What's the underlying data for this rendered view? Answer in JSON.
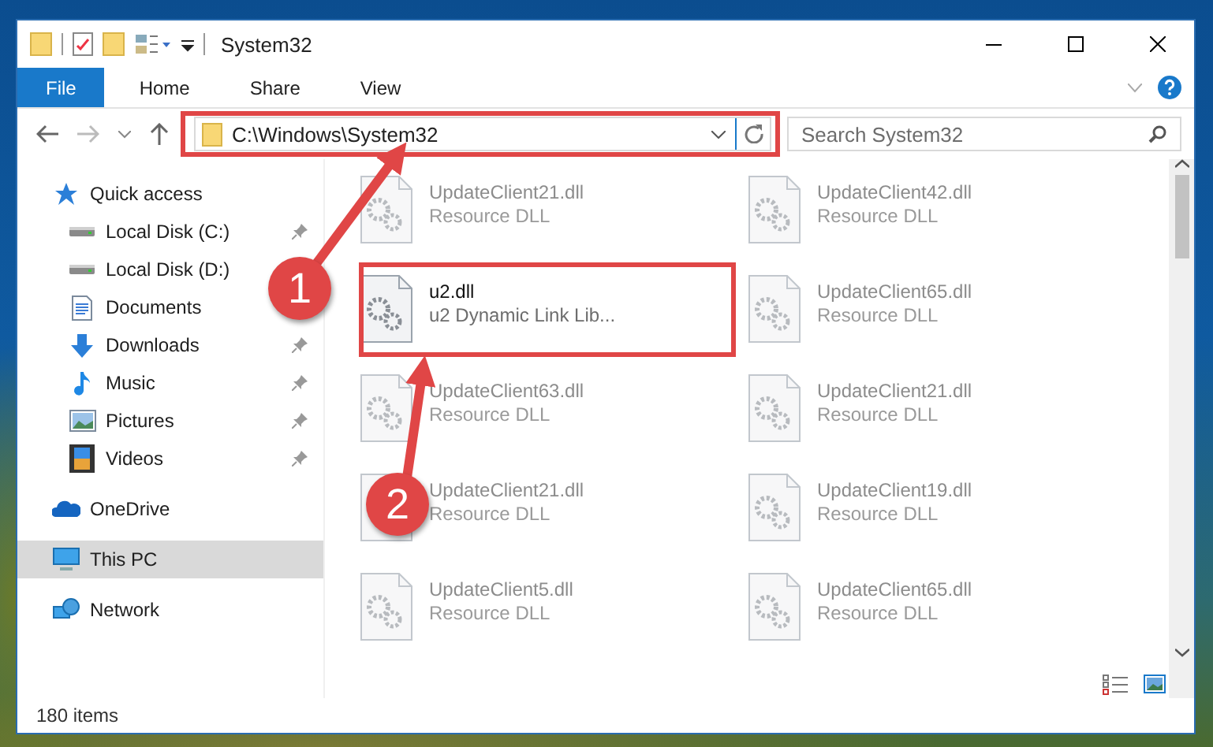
{
  "window": {
    "title": "System32"
  },
  "ribbon": {
    "tabs": [
      {
        "label": "File",
        "selected": true
      },
      {
        "label": "Home",
        "selected": false
      },
      {
        "label": "Share",
        "selected": false
      },
      {
        "label": "View",
        "selected": false
      }
    ]
  },
  "address_bar": {
    "path": "C:\\Windows\\System32"
  },
  "search": {
    "placeholder": "Search System32"
  },
  "sidebar": {
    "items": [
      {
        "label": "Quick access",
        "kind": "group",
        "pinned": false,
        "selected": false
      },
      {
        "label": "Local Disk (C:)",
        "kind": "item",
        "pinned": true,
        "selected": false
      },
      {
        "label": "Local Disk (D:)",
        "kind": "item",
        "pinned": false,
        "selected": false
      },
      {
        "label": "Documents",
        "kind": "item",
        "pinned": false,
        "selected": false
      },
      {
        "label": "Downloads",
        "kind": "item",
        "pinned": true,
        "selected": false
      },
      {
        "label": "Music",
        "kind": "item",
        "pinned": true,
        "selected": false
      },
      {
        "label": "Pictures",
        "kind": "item",
        "pinned": true,
        "selected": false
      },
      {
        "label": "Videos",
        "kind": "item",
        "pinned": true,
        "selected": false
      },
      {
        "label": "OneDrive",
        "kind": "group",
        "pinned": false,
        "selected": false
      },
      {
        "label": "This PC",
        "kind": "group",
        "pinned": false,
        "selected": true
      },
      {
        "label": "Network",
        "kind": "group",
        "pinned": false,
        "selected": false
      }
    ]
  },
  "files": [
    {
      "name": "UpdateClient21.dll",
      "type": "Resource DLL",
      "faded": true
    },
    {
      "name": "UpdateClient42.dll",
      "type": "Resource DLL",
      "faded": true
    },
    {
      "name": "u2.dll",
      "type": "u2 Dynamic Link Lib...",
      "faded": false
    },
    {
      "name": "UpdateClient65.dll",
      "type": "Resource DLL",
      "faded": true
    },
    {
      "name": "UpdateClient63.dll",
      "type": "Resource DLL",
      "faded": true
    },
    {
      "name": "UpdateClient21.dll",
      "type": "Resource DLL",
      "faded": true
    },
    {
      "name": "UpdateClient21.dll",
      "type": "Resource DLL",
      "faded": true
    },
    {
      "name": "UpdateClient19.dll",
      "type": "Resource DLL",
      "faded": true
    },
    {
      "name": "UpdateClient5.dll",
      "type": "Resource DLL",
      "faded": true
    },
    {
      "name": "UpdateClient65.dll",
      "type": "Resource DLL",
      "faded": true
    }
  ],
  "status_bar": {
    "item_count": "180 items"
  },
  "annotations": [
    {
      "label": "1"
    },
    {
      "label": "2"
    }
  ]
}
